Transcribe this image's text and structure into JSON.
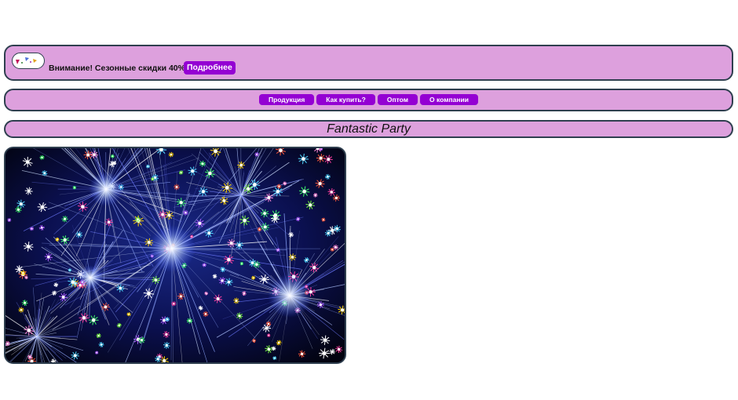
{
  "promo": {
    "logo_icon": "party-hat-logo-icon",
    "text": "Внимание! Сезонные скидки 40%",
    "more_label": "Подробнее"
  },
  "nav": {
    "items": [
      {
        "label": "Продукция"
      },
      {
        "label": "Как купить?"
      },
      {
        "label": "Оптом"
      },
      {
        "label": "О компании"
      }
    ]
  },
  "page": {
    "title": "Fantastic Party"
  },
  "hero": {
    "image": "fireworks-image"
  },
  "colors": {
    "panel_bg": "#dda0dd",
    "panel_border": "#2f3f4f",
    "button_bg": "#9400d3",
    "button_text": "#ffffff"
  }
}
